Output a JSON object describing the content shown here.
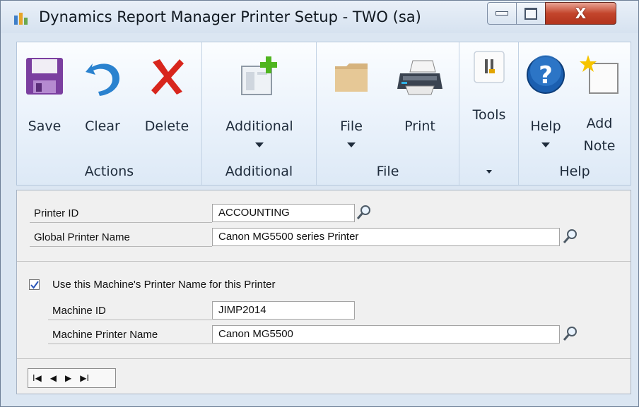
{
  "window": {
    "title": "Dynamics Report Manager Printer Setup  -  TWO (sa)",
    "icon": "report-manager-icon",
    "controls": {
      "minimize": "minimize-icon",
      "maximize": "maximize-icon",
      "close": "X"
    }
  },
  "ribbon": {
    "groups": [
      {
        "label": "Actions",
        "buttons": [
          {
            "label": "Save",
            "icon": "save-disk-icon"
          },
          {
            "label": "Clear",
            "icon": "undo-arrow-icon"
          },
          {
            "label": "Delete",
            "icon": "red-x-icon"
          }
        ]
      },
      {
        "label": "Additional",
        "buttons": [
          {
            "label": "Additional",
            "icon": "window-add-icon",
            "dropdown": true
          }
        ]
      },
      {
        "label": "File",
        "buttons": [
          {
            "label": "File",
            "icon": "folder-icon",
            "dropdown": true
          },
          {
            "label": "Print",
            "icon": "printer-icon"
          }
        ]
      },
      {
        "label": "",
        "buttons": [
          {
            "label": "Tools",
            "icon": "tools-icon"
          }
        ]
      },
      {
        "label": "Help",
        "buttons": [
          {
            "label": "Help",
            "icon": "help-question-icon",
            "dropdown": true
          },
          {
            "label_line1": "Add",
            "label_line2": "Note",
            "icon": "note-star-icon"
          }
        ]
      }
    ]
  },
  "form": {
    "printer_id": {
      "label": "Printer ID",
      "value": "ACCOUNTING"
    },
    "global_printer_name": {
      "label": "Global Printer Name",
      "value": "Canon MG5500 series Printer"
    },
    "use_machine_printer": {
      "label": "Use this Machine's Printer Name for this Printer",
      "checked": true
    },
    "machine_id": {
      "label": "Machine ID",
      "value": "JIMP2014"
    },
    "machine_printer_name": {
      "label": "Machine Printer Name",
      "value": "Canon MG5500"
    }
  },
  "navigation": {
    "first": "I◀",
    "previous": "◀",
    "next": "▶",
    "last": "▶I"
  },
  "colors": {
    "ribbon_top": "#fbfdff",
    "ribbon_bottom": "#dde9f6",
    "window_frame": "#dbe6f2",
    "close_button": "#c3452c",
    "form_background": "#f0f0f0"
  }
}
